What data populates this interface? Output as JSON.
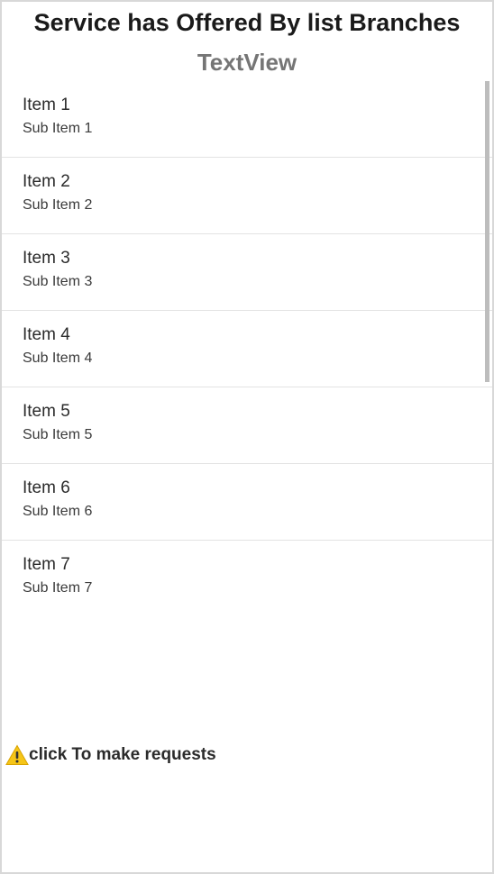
{
  "header": {
    "title": "Service has Offered By list Branches",
    "subtitle": "TextView"
  },
  "list": {
    "items": [
      {
        "title": "Item 1",
        "subtitle": "Sub Item 1"
      },
      {
        "title": "Item 2",
        "subtitle": "Sub Item 2"
      },
      {
        "title": "Item 3",
        "subtitle": "Sub Item 3"
      },
      {
        "title": "Item 4",
        "subtitle": "Sub Item 4"
      },
      {
        "title": "Item 5",
        "subtitle": "Sub Item 5"
      },
      {
        "title": "Item 6",
        "subtitle": "Sub Item 6"
      },
      {
        "title": "Item 7",
        "subtitle": "Sub Item 7"
      }
    ]
  },
  "footer": {
    "request_label": "click To make requests",
    "icon": "warning-icon"
  },
  "colors": {
    "warning": "#f5c518"
  }
}
